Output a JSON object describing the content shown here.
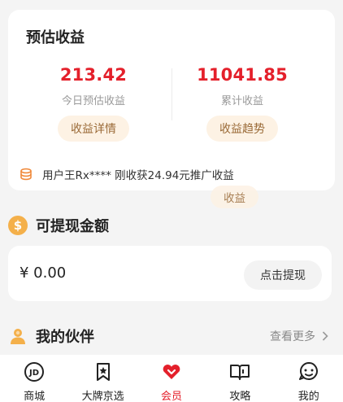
{
  "estimate": {
    "title": "预估收益",
    "today_value": "213.42",
    "today_label": "今日预估收益",
    "today_button": "收益详情",
    "total_value": "11041.85",
    "total_label": "累计收益",
    "total_button": "收益趋势",
    "ticker_text": "用户王Rx**** 刚收获24.94元推广收益",
    "ghost_button": "收益"
  },
  "withdraw": {
    "icon_symbol": "$",
    "title": "可提现金额",
    "amount": "¥ 0.00",
    "button": "点击提现"
  },
  "partners": {
    "title": "我的伙伴",
    "see_more": "查看更多"
  },
  "tabbar": {
    "items": [
      {
        "label": "商城",
        "icon": "jd-icon"
      },
      {
        "label": "大牌京选",
        "icon": "bookmark-star-icon"
      },
      {
        "label": "会员",
        "icon": "heart-icon"
      },
      {
        "label": "攻略",
        "icon": "book-icon"
      },
      {
        "label": "我的",
        "icon": "smile-icon"
      }
    ]
  },
  "colors": {
    "accent_red": "#e4202b",
    "pill_bg": "#fdf2e4",
    "pill_text": "#9a6a37",
    "coin_orange": "#f4b04a"
  }
}
